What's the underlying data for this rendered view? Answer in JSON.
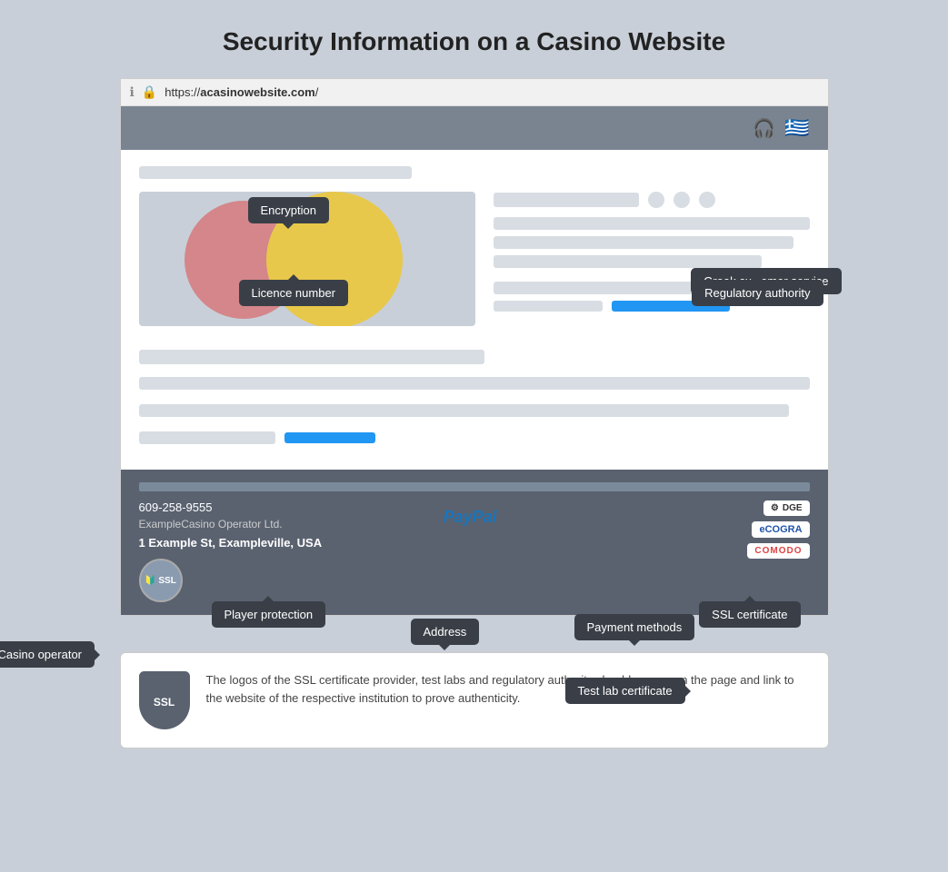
{
  "page": {
    "title": "Security Information on a Casino Website"
  },
  "browser": {
    "url_prefix": "https://",
    "url_bold": "acasinowebsite.com",
    "url_suffix": "/"
  },
  "tooltips": {
    "encryption": "Encryption",
    "greek_service": "Greek customer service",
    "licence_number": "Licence number",
    "regulatory_authority": "Regulatory authority",
    "player_protection": "Player protection",
    "ssl_certificate": "SSL certificate",
    "casino_operator": "Casino operator",
    "address": "Address",
    "payment_methods": "Payment methods",
    "test_lab": "Test lab certificate"
  },
  "footer": {
    "phone": "609-258-9555",
    "operator": "ExampleCasino Operator Ltd.",
    "address": "1 Example St, Exampleville, USA",
    "ssl_text": "SSL",
    "paypal": "PayPal",
    "ecogra": "eCOGRA",
    "comodo": "COMODO",
    "dge_label": "DGE"
  },
  "info_box": {
    "ssl_label": "SSL",
    "text": "The logos of the SSL certificate provider, test labs and regulatory authority should appear on the page and link to the website of the respective institution to prove authenticity."
  }
}
